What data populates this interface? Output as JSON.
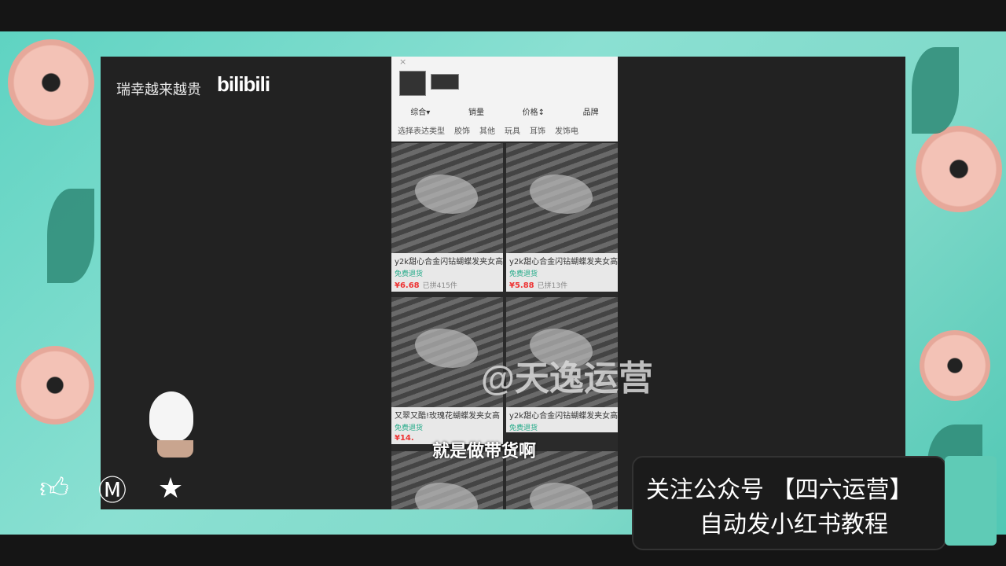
{
  "channel": {
    "name": "瑞幸越来越贵",
    "logo_text": "bilibili"
  },
  "phone_screen": {
    "sort_options": [
      "综合▾",
      "销量",
      "价格↕",
      "品牌"
    ],
    "filters": [
      "选择表达类型",
      "胶饰",
      "其他",
      "玩具",
      "耳饰",
      "发饰电"
    ],
    "products": [
      {
        "title": "y2k甜心合金闪钻蝴蝶发夹女高",
        "tag": "免费退货",
        "price": "¥6.68",
        "sold": "已拼415件"
      },
      {
        "title": "y2k甜心合金闪钻蝴蝶发夹女高",
        "tag": "免费退货",
        "price": "¥5.88",
        "sold": "已拼13件"
      },
      {
        "title": "又翠又酷!玫瑰花蝴蝶发夹女高",
        "tag": "免费退货",
        "price": "¥14.",
        "sold": ""
      },
      {
        "title": "y2k甜心合金闪钻蝴蝶发夹女高",
        "tag": "免费退货",
        "price": "",
        "sold": ""
      }
    ]
  },
  "watermark": "@天逸运营",
  "subtitle": "就是做带货啊",
  "promo": {
    "line1": "关注公众号 【四六运营】",
    "line2": "自动发小红书教程"
  },
  "actions": {
    "like_icon": "thumbs-up-icon",
    "coin_icon": "coin-icon",
    "favorite_icon": "star-icon"
  },
  "colors": {
    "accent_teal": "#5fd3c2",
    "flower_pink": "#f3c2b6",
    "price_red": "#e33"
  }
}
